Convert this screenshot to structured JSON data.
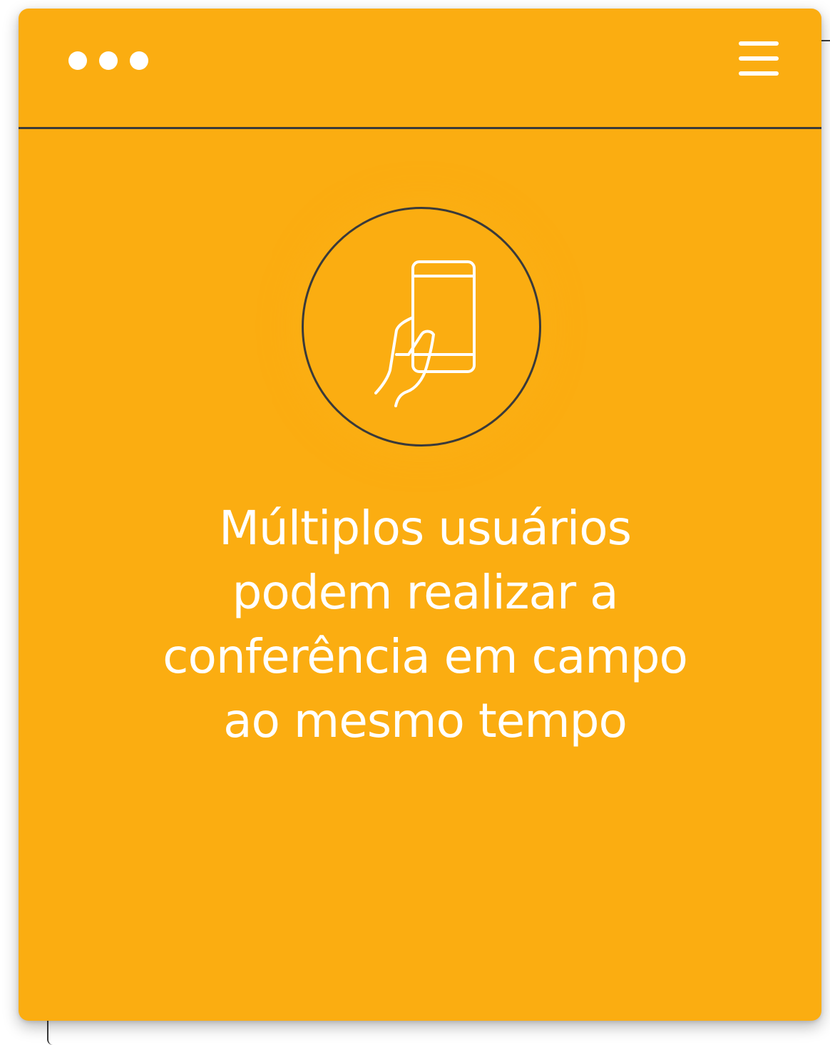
{
  "colors": {
    "card_background": "#fbad11",
    "foreground": "#ffffff",
    "outline": "#3a3a3a"
  },
  "header": {
    "window_controls_icon": "three-dots-icon",
    "menu_icon": "hamburger-menu-icon"
  },
  "feature": {
    "icon": "hand-holding-phone-icon",
    "text": "Múltiplos usuários podem realizar a conferência em campo ao mesmo tempo"
  }
}
